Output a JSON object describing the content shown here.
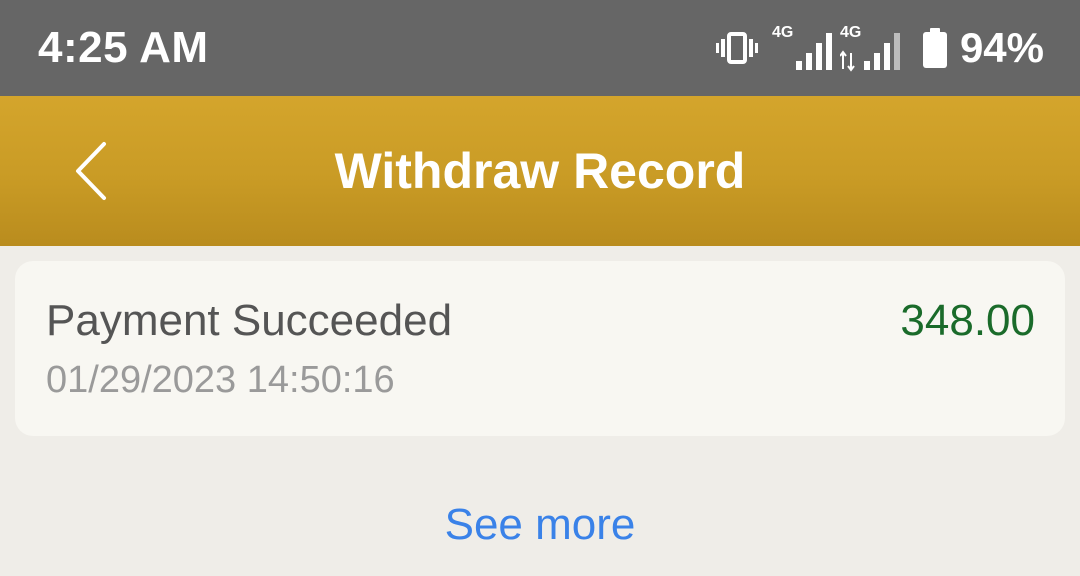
{
  "status_bar": {
    "time": "4:25 AM",
    "network_1": "4G",
    "network_2": "4G",
    "battery": "94%",
    "icons": [
      "vibrate-icon",
      "signal-icon",
      "signal-icon",
      "battery-icon"
    ]
  },
  "app_bar": {
    "title": "Withdraw Record",
    "back_icon": "chevron-left-icon",
    "color": "#c99b25"
  },
  "records": [
    {
      "status": "Payment Succeeded",
      "datetime": "01/29/2023 14:50:16",
      "amount": "348.00",
      "amount_color": "#1a6b2a"
    }
  ],
  "footer": {
    "see_more_label": "See more",
    "link_color": "#3a82e8"
  }
}
